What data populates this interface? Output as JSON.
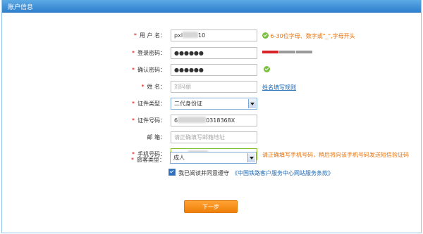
{
  "title": "账户信息",
  "fields": [
    {
      "key": "username",
      "label": "用 户 名：",
      "value": "pxl",
      "value_suffix": "10",
      "hint": "6-30位字母、数字或\"_\",字母开头"
    },
    {
      "key": "password",
      "label": "登录密码：",
      "value": "●●●●●●"
    },
    {
      "key": "confirm",
      "label": "确认密码：",
      "value": "●●●●●●"
    },
    {
      "key": "name",
      "label": "姓 名：",
      "placeholder": "刘玛丽",
      "link": "姓名填写规则"
    },
    {
      "key": "id_type",
      "label": "证件类型：",
      "value": "二代身份证"
    },
    {
      "key": "id_number",
      "label": "证件号码：",
      "value": "6",
      "value_suffix": "0318368X"
    },
    {
      "key": "email",
      "label": "邮 箱：",
      "placeholder": "请正确填写邮箱地址"
    },
    {
      "key": "phone",
      "label": "手机号码：",
      "value": "1345",
      "value_suffix": "571",
      "hint": "请正确填写手机号码，稍后将向该手机号码发送短信验证码"
    },
    {
      "key": "passenger_type",
      "label": "旅客类型：",
      "value": "成人"
    }
  ],
  "agree": {
    "text": "我已阅读并同意遵守",
    "link": "《中国铁路客户服务中心网站服务条款》"
  },
  "next_button": "下一步",
  "colors": {
    "accent": "#2f80cf",
    "hint": "#e8720c",
    "button": "#f28a18",
    "strength_weak": "#d9232a",
    "strength_empty": "#9a9a9a"
  }
}
